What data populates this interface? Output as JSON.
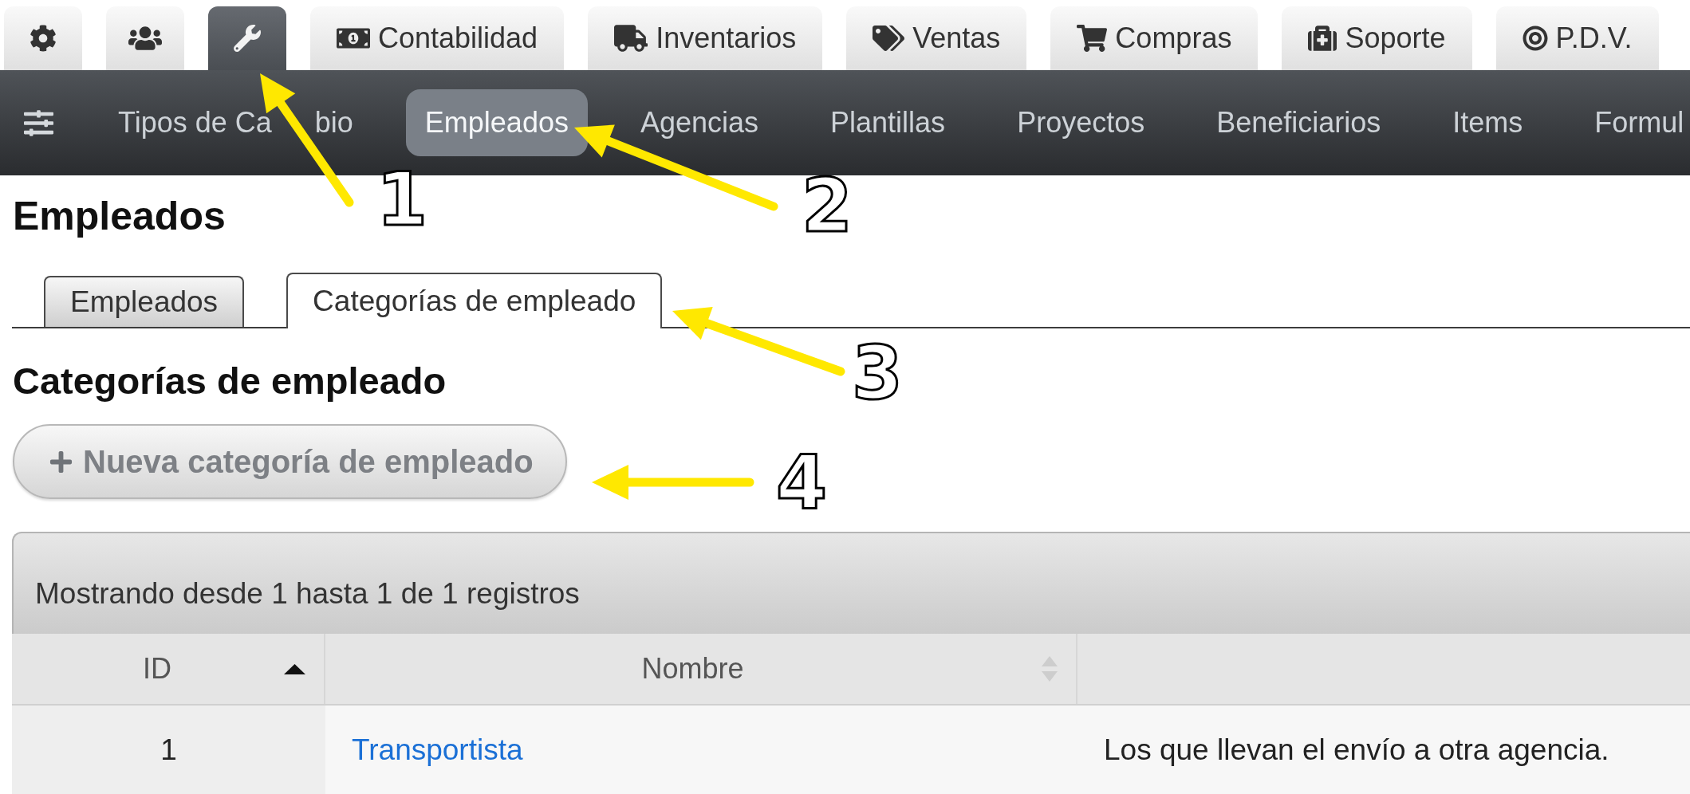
{
  "module_tabs": [
    {
      "selected": false
    },
    {
      "selected": false
    },
    {
      "selected": true
    },
    {
      "label": "Contabilidad",
      "selected": false
    },
    {
      "label": "Inventarios",
      "selected": false
    },
    {
      "label": "Ventas",
      "selected": false
    },
    {
      "label": "Compras",
      "selected": false
    },
    {
      "label": "Soporte",
      "selected": false
    },
    {
      "label": "P.D.V.",
      "selected": false
    }
  ],
  "nav": {
    "items": [
      {
        "label": "Tipos de Ca",
        "label_tail": "bio",
        "selected": false
      },
      {
        "label": "Empleados",
        "selected": true
      },
      {
        "label": "Agencias",
        "selected": false
      },
      {
        "label": "Plantillas",
        "selected": false
      },
      {
        "label": "Proyectos",
        "selected": false
      },
      {
        "label": "Beneficiarios",
        "selected": false
      },
      {
        "label": "Items",
        "selected": false
      },
      {
        "label": "Formul",
        "selected": false
      }
    ]
  },
  "page": {
    "title": "Empleados",
    "tabs": [
      {
        "label": "Empleados",
        "selected": false
      },
      {
        "label": "Categorías de empleado",
        "selected": true
      }
    ],
    "section_title": "Categorías de empleado",
    "new_button": "Nueva categoría de empleado"
  },
  "table": {
    "info": "Mostrando desde 1 hasta 1 de 1 registros",
    "columns": [
      {
        "label": "ID",
        "sorted": true
      },
      {
        "label": "Nombre",
        "sorted": false
      }
    ],
    "rows": [
      {
        "cells": [
          {
            "kind": "text",
            "text": "1"
          },
          {
            "kind": "link",
            "text": "Transportista"
          },
          {
            "kind": "text",
            "text": "Los que llevan el envío a otra agencia."
          }
        ]
      }
    ]
  },
  "callouts": [
    {
      "label": "1"
    },
    {
      "label": "2"
    },
    {
      "label": "3"
    },
    {
      "label": "4"
    }
  ]
}
